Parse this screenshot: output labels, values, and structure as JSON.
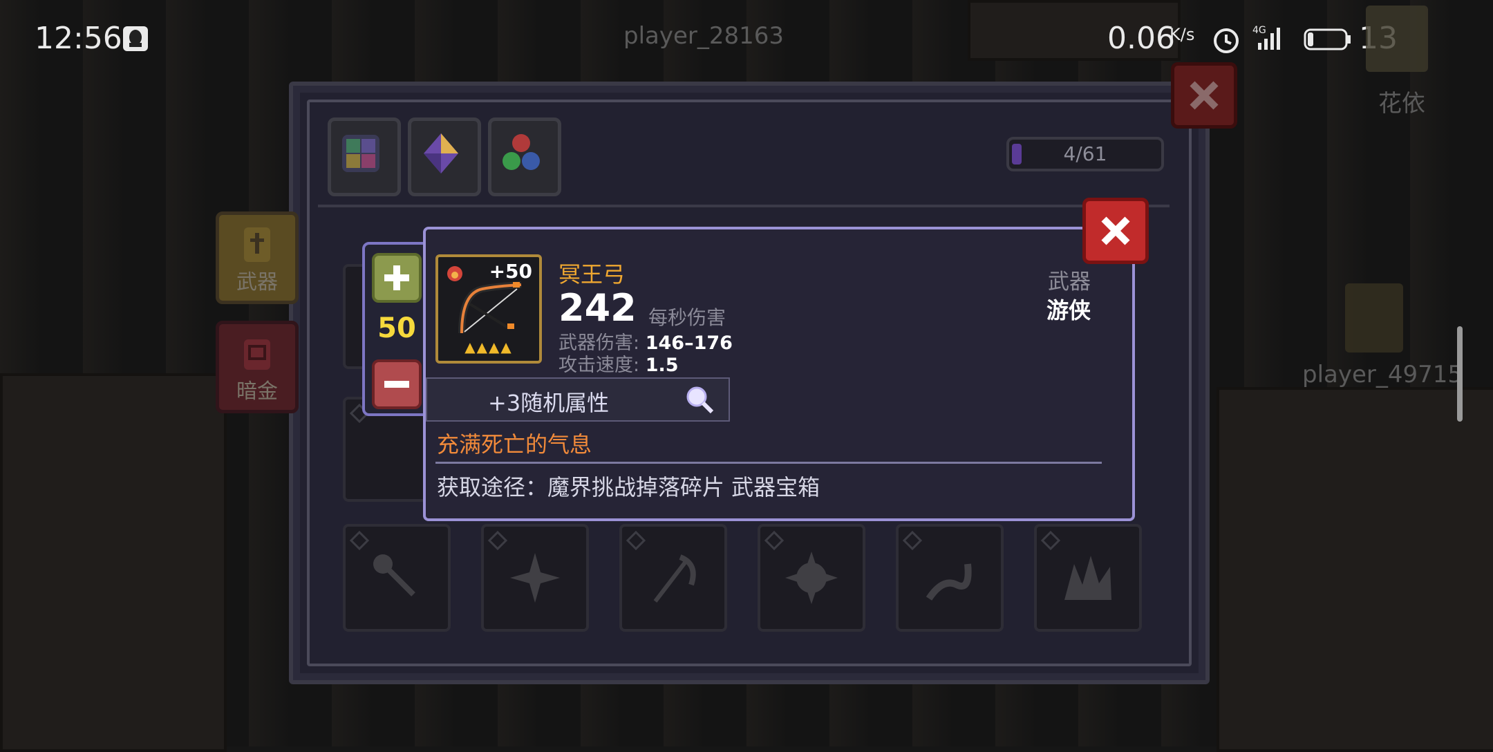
{
  "status_bar": {
    "time": "12:56",
    "net_speed": "0.06",
    "net_unit": "K/s",
    "signal": "4G",
    "battery": "13"
  },
  "world": {
    "player_top": "player_28163",
    "player_right": "player_49715",
    "npc_name": "花依"
  },
  "inventory": {
    "capacity": "4/61",
    "capacity_fraction": 0.066,
    "side_tabs": [
      {
        "label": "武器",
        "icon": "sword-icon"
      },
      {
        "label": "暗金",
        "icon": "chest-icon"
      }
    ],
    "filter_tabs": [
      {
        "icon": "all-items-grid-icon"
      },
      {
        "icon": "gem-icon"
      },
      {
        "icon": "orbs-icon"
      }
    ],
    "slots": [
      {
        "icon": "scepter-icon"
      },
      {
        "icon": "shuriken-icon"
      },
      {
        "icon": "scythe-icon"
      },
      {
        "icon": "spiked-orb-icon"
      },
      {
        "icon": "serpent-blade-icon"
      },
      {
        "icon": "spiked-crown-icon"
      }
    ]
  },
  "stepper": {
    "value": "50"
  },
  "item": {
    "name": "冥王弓",
    "enhance": "+50",
    "stars": "▲▲▲▲",
    "dps": "242",
    "dps_label": "每秒伤害",
    "damage_label": "武器伤害:",
    "damage_value": "146–176",
    "speed_label": "攻击速度:",
    "speed_value": "1.5",
    "type": "武器",
    "class": "游侠",
    "random_attr": "+3随机属性",
    "flavor": "充满死亡的气息",
    "source": "获取途径：魔界挑战掉落碎片 武器宝箱"
  },
  "colors": {
    "accent_gold": "#f0a830",
    "flavor_orange": "#f18a3a",
    "card_border": "#9b92d6",
    "close_red": "#c12b2b"
  }
}
